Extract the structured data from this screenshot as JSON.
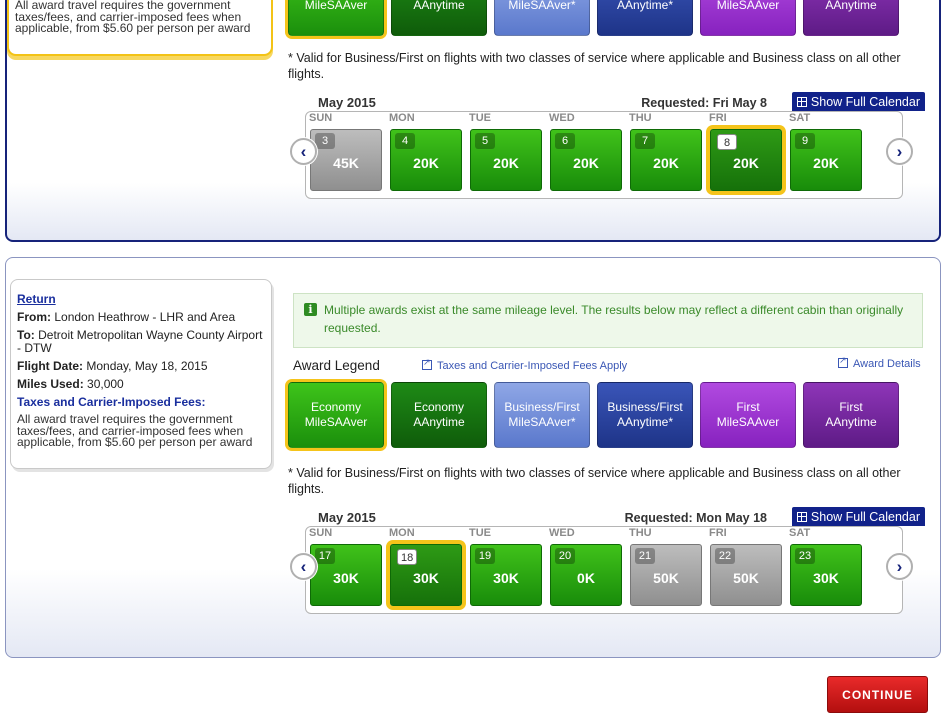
{
  "outbound": {
    "fees_text": "All award travel requires the government taxes/fees, and carrier-imposed fees when applicable, from $5.60 per person per award",
    "awards": [
      {
        "label": "MileSAAver"
      },
      {
        "label": "AAnytime"
      },
      {
        "label": "MileSAAver*"
      },
      {
        "label": "AAnytime*"
      },
      {
        "label": "MileSAAver"
      },
      {
        "label": "AAnytime"
      }
    ],
    "valid_note": "* Valid for Business/First on flights with two classes of service where applicable and Business class on all other flights.",
    "calendar": {
      "month": "May 2015",
      "requested": "Requested: Fri May 8",
      "full_calendar": "Show Full Calendar",
      "days": [
        "SUN",
        "MON",
        "TUE",
        "WED",
        "THU",
        "FRI",
        "SAT"
      ],
      "cells": [
        {
          "day": "3",
          "miles": "45K",
          "state": "grey"
        },
        {
          "day": "4",
          "miles": "20K",
          "state": "green"
        },
        {
          "day": "5",
          "miles": "20K",
          "state": "green"
        },
        {
          "day": "6",
          "miles": "20K",
          "state": "green"
        },
        {
          "day": "7",
          "miles": "20K",
          "state": "green"
        },
        {
          "day": "8",
          "miles": "20K",
          "state": "selected"
        },
        {
          "day": "9",
          "miles": "20K",
          "state": "green"
        }
      ]
    }
  },
  "return": {
    "link": "Return",
    "from_label": "From:",
    "from": "London Heathrow - LHR and Area",
    "to_label": "To:",
    "to": "Detroit Metropolitan Wayne County Airport - DTW",
    "date_label": "Flight Date:",
    "date": "Monday, May 18, 2015",
    "miles_label": "Miles Used:",
    "miles": "30,000",
    "fees_title": "Taxes and Carrier-Imposed Fees:",
    "fees_text": "All award travel requires the government taxes/fees, and carrier-imposed fees when applicable, from $5.60 per person per award",
    "notice_icon": "i",
    "notice": "Multiple awards exist at the same mileage level. The results below may reflect a different cabin than originally requested.",
    "legend_title": "Award Legend",
    "taxes_link": "Taxes and Carrier-Imposed Fees Apply",
    "details_link": "Award Details",
    "awards": [
      {
        "line1": "Economy",
        "line2": "MileSAAver"
      },
      {
        "line1": "Economy",
        "line2": "AAnytime"
      },
      {
        "line1": "Business/First",
        "line2": "MileSAAver*"
      },
      {
        "line1": "Business/First",
        "line2": "AAnytime*"
      },
      {
        "line1": "First",
        "line2": "MileSAAver"
      },
      {
        "line1": "First",
        "line2": "AAnytime"
      }
    ],
    "valid_note": "* Valid for Business/First on flights with two classes of service where applicable and Business class on all other flights.",
    "calendar": {
      "month": "May 2015",
      "requested": "Requested: Mon May 18",
      "full_calendar": "Show Full Calendar",
      "days": [
        "SUN",
        "MON",
        "TUE",
        "WED",
        "THU",
        "FRI",
        "SAT"
      ],
      "cells": [
        {
          "day": "17",
          "miles": "30K",
          "state": "green"
        },
        {
          "day": "18",
          "miles": "30K",
          "state": "selected"
        },
        {
          "day": "19",
          "miles": "30K",
          "state": "green"
        },
        {
          "day": "20",
          "miles": "0K",
          "state": "green"
        },
        {
          "day": "21",
          "miles": "50K",
          "state": "grey"
        },
        {
          "day": "22",
          "miles": "50K",
          "state": "grey"
        },
        {
          "day": "23",
          "miles": "30K",
          "state": "green"
        }
      ]
    }
  },
  "continue_label": "CONTINUE",
  "icons": {
    "prev": "chevron-left-icon",
    "next": "chevron-right-icon",
    "calendar": "calendar-grid-icon"
  }
}
